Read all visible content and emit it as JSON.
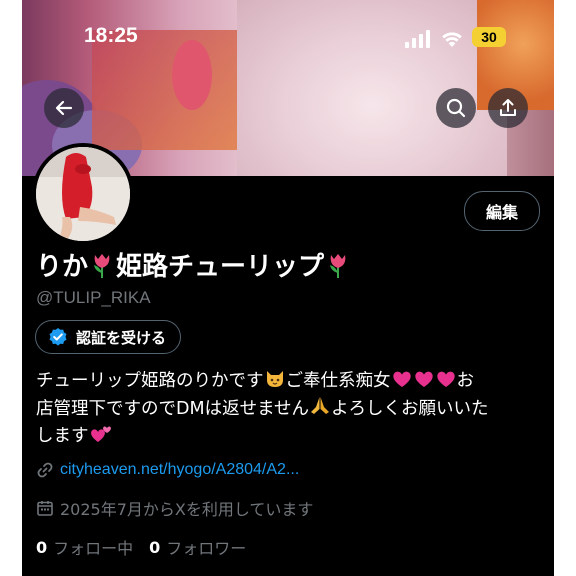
{
  "status_bar": {
    "time": "18:25",
    "battery": "30"
  },
  "profile": {
    "display_name": "りか",
    "display_name_middle": "姫路チューリップ",
    "handle": "@TULIP_RIKA",
    "edit_label": "編集",
    "verify_label": "認証を受ける",
    "bio_line1": "チューリップ姫路のりかです",
    "bio_line1b": "ご奉仕系痴女",
    "bio_line1c": "お",
    "bio_line2a": "店管理下ですのでDMは返せません",
    "bio_line2b": "よろしくお願いいた",
    "bio_line3": "します",
    "link": "cityheaven.net/hyogo/A2804/A2...",
    "joined": "2025年7月からXを利用しています",
    "following_count": "0",
    "following_label": "フォロー中",
    "followers_count": "0",
    "followers_label": "フォロワー"
  },
  "colors": {
    "background": "#000000",
    "link": "#1d9bf0",
    "muted": "#71767b",
    "verified": "#1d9bf0",
    "heart": "#e8318f"
  }
}
